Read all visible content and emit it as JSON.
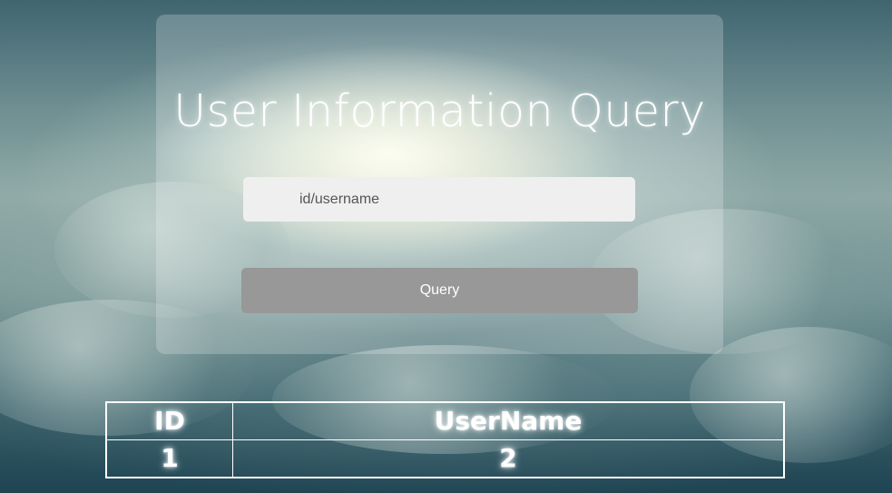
{
  "page": {
    "title": "User Information Query"
  },
  "search": {
    "placeholder": "id/username",
    "value": ""
  },
  "query_button": {
    "label": "Query"
  },
  "table": {
    "headers": [
      "ID",
      "UserName"
    ],
    "rows": [
      [
        "1",
        "2"
      ]
    ]
  },
  "colors": {
    "panel": "rgba(255,255,255,0.22)",
    "input_bg": "#efefef",
    "button_bg": "#989898",
    "text": "#ffffff"
  }
}
